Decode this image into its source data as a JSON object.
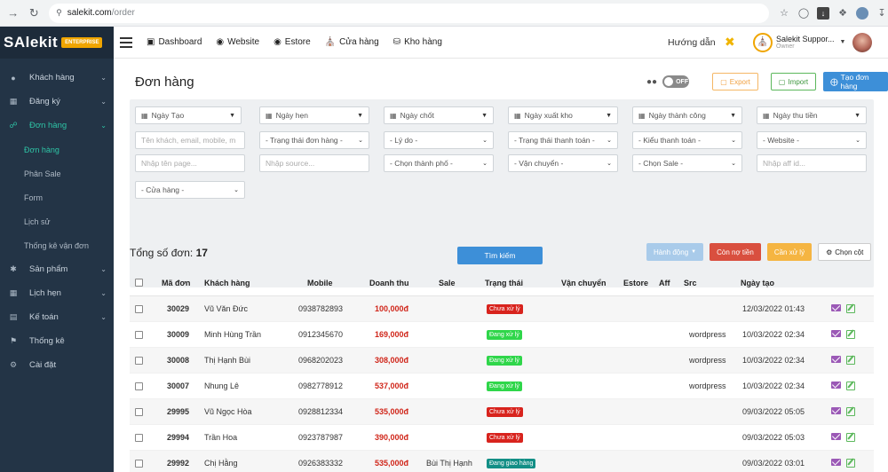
{
  "browser": {
    "url_domain": "salekit.com",
    "url_path": "/order"
  },
  "brand": {
    "name": "SAlekit",
    "badge": "ENTERPRISE"
  },
  "sidebar": {
    "items": [
      {
        "label": "Khách hàng",
        "icon": "user-icon",
        "has_chevron": true
      },
      {
        "label": "Đăng ký",
        "icon": "register-icon",
        "has_chevron": true
      },
      {
        "label": "Đơn hàng",
        "icon": "cart-icon",
        "has_chevron": true,
        "active": true
      },
      {
        "label": "Sản phẩm",
        "icon": "product-icon",
        "has_chevron": true
      },
      {
        "label": "Lịch hẹn",
        "icon": "calendar-icon",
        "has_chevron": true
      },
      {
        "label": "Kế toán",
        "icon": "accounting-icon",
        "has_chevron": true
      },
      {
        "label": "Thống kê",
        "icon": "flag-icon",
        "has_chevron": false
      },
      {
        "label": "Cài đặt",
        "icon": "gear-icon",
        "has_chevron": false
      }
    ],
    "sub_items": [
      "Đơn hàng",
      "Phân Sale",
      "Form",
      "Lịch sử",
      "Thống kê vận đơn"
    ]
  },
  "topnav": {
    "links": [
      {
        "label": "Dashboard",
        "icon": "monitor-icon"
      },
      {
        "label": "Website",
        "icon": "globe-icon"
      },
      {
        "label": "Estore",
        "icon": "globe-icon"
      },
      {
        "label": "Cửa hàng",
        "icon": "store-icon"
      },
      {
        "label": "Kho hàng",
        "icon": "database-icon"
      }
    ],
    "guide": "Hướng dẫn",
    "user_name": "Salekit Suppor...",
    "user_role": "Owner"
  },
  "page": {
    "title": "Đơn hàng",
    "toggle_label": "OFF",
    "export_label": "Export",
    "import_label": "Import",
    "create_label": "Tạo đơn hàng"
  },
  "filters": {
    "row1": [
      "Ngày Tạo",
      "Ngày hẹn",
      "Ngày chốt",
      "Ngày xuất kho",
      "Ngày thành công",
      "Ngày thu tiền"
    ],
    "row2": [
      "Tên khách, email, mobile, m",
      "- Trạng thái đơn hàng -",
      "- Lý do -",
      "- Trạng thái thanh toán -",
      "- Kiểu thanh toán -",
      "- Website -"
    ],
    "row3": [
      "Nhập tên page...",
      "Nhập source...",
      "- Chọn thành phố -",
      "- Vận chuyển -",
      "- Chọn Sale -",
      "Nhập aff id..."
    ],
    "row4": [
      "- Cửa hàng -"
    ],
    "search_label": "Tìm kiếm"
  },
  "summary": {
    "total_label": "Tổng số đơn:",
    "total_value": "17",
    "actions_label": "Hành động",
    "debt_label": "Còn nợ tiền",
    "pending_label": "Cần xử lý",
    "columns_label": "Chọn cột"
  },
  "table": {
    "headers": [
      "Mã đơn",
      "Khách hàng",
      "Mobile",
      "Doanh thu",
      "Sale",
      "Trạng thái",
      "Vận chuyển",
      "Estore",
      "Aff",
      "Src",
      "Ngày tạo"
    ],
    "rows": [
      {
        "id": "30029",
        "customer": "Vũ Văn Đức",
        "mobile": "0938782893",
        "revenue": "100,000đ",
        "sale": "",
        "status": "Chưa xử lý",
        "status_color": "red",
        "src": "",
        "created": "12/03/2022 01:43"
      },
      {
        "id": "30009",
        "customer": "Minh Hùng Trần",
        "mobile": "0912345670",
        "revenue": "169,000đ",
        "sale": "",
        "status": "Đang xử lý",
        "status_color": "green",
        "src": "wordpress",
        "created": "10/03/2022 02:34"
      },
      {
        "id": "30008",
        "customer": "Thị Hạnh Bùi",
        "mobile": "0968202023",
        "revenue": "308,000đ",
        "sale": "",
        "status": "Đang xử lý",
        "status_color": "green",
        "src": "wordpress",
        "created": "10/03/2022 02:34"
      },
      {
        "id": "30007",
        "customer": "Nhung Lê",
        "mobile": "0982778912",
        "revenue": "537,000đ",
        "sale": "",
        "status": "Đang xử lý",
        "status_color": "green",
        "src": "wordpress",
        "created": "10/03/2022 02:34"
      },
      {
        "id": "29995",
        "customer": "Vũ Ngọc Hòa",
        "mobile": "0928812334",
        "revenue": "535,000đ",
        "sale": "",
        "status": "Chưa xử lý",
        "status_color": "red",
        "src": "",
        "created": "09/03/2022 05:05"
      },
      {
        "id": "29994",
        "customer": "Trần Hoa",
        "mobile": "0923787987",
        "revenue": "390,000đ",
        "sale": "",
        "status": "Chưa xử lý",
        "status_color": "red",
        "src": "",
        "created": "09/03/2022 05:03"
      },
      {
        "id": "29992",
        "customer": "Chị Hằng",
        "mobile": "0926383332",
        "revenue": "535,000đ",
        "sale": "Bùi Thị Hạnh",
        "status": "Đang giao hàng",
        "status_color": "teal",
        "src": "",
        "created": "09/03/2022 03:01"
      }
    ]
  },
  "colors": {
    "sidebar_bg": "#233446",
    "accent_teal": "#2ec4a6",
    "primary_blue": "#3d8fd8",
    "revenue_red": "#d0261a"
  }
}
